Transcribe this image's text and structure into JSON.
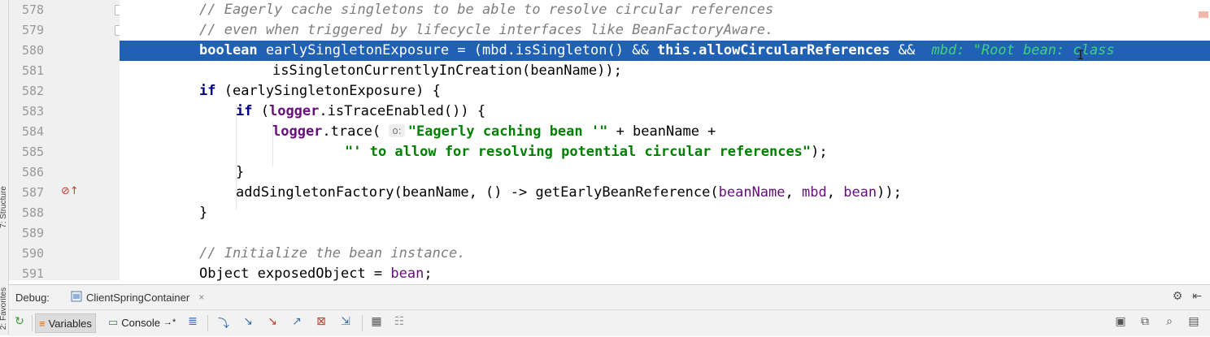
{
  "gutter": {
    "line_numbers": [
      "578",
      "579",
      "580",
      "581",
      "582",
      "583",
      "584",
      "585",
      "586",
      "587",
      "588",
      "589",
      "590",
      "591"
    ]
  },
  "code": {
    "l578": "// Eagerly cache singletons to be able to resolve circular references",
    "l579": "// even when triggered by lifecycle interfaces like BeanFactoryAware.",
    "l580_kw": "boolean",
    "l580_a": " earlySingletonExposure = (mbd.isSingleton() && ",
    "l580_this": "this",
    "l580_b": ".allowCircularReferences",
    "l580_c": " && ",
    "l580_hint": "mbd: \"Root bean: class",
    "l581": "isSingletonCurrentlyInCreation(beanName));",
    "l582_kw": "if",
    "l582": " (earlySingletonExposure) {",
    "l583_kw": "if",
    "l583_a": " (",
    "l583_logger": "logger",
    "l583_b": ".isTraceEnabled()) {",
    "l584_logger": "logger",
    "l584_a": ".trace( ",
    "l584_hint": "o:",
    "l584_str": "\"Eagerly caching bean '\"",
    "l584_b": " + beanName +",
    "l585_str": "\"' to allow for resolving potential circular references\"",
    "l585_b": ");",
    "l586": "}",
    "l587_a": "addSingletonFactory(beanName, () -> getEarlyBeanReference(",
    "l587_p1": "beanName",
    "l587_c1": ", ",
    "l587_p2": "mbd",
    "l587_c2": ", ",
    "l587_p3": "bean",
    "l587_b": "));",
    "l588": "}",
    "l589": "",
    "l590": "// Initialize the bean instance.",
    "l591_a": "Object exposedObject = ",
    "l591_p": "bean",
    "l591_b": ";"
  },
  "debug": {
    "title": "Debug:",
    "session_name": "ClientSpringContainer",
    "close_glyph": "×",
    "settings_glyph": "⚙",
    "minimize_glyph": "⇤",
    "variables_label": "Variables",
    "console_label": "Console",
    "console_suffix": "→*"
  },
  "left_strip": {
    "structure_label": "7: Structure",
    "favorites_label": "2: Favorites"
  },
  "colors": {
    "current_line": "#2161b5",
    "comment": "#7d7d7d",
    "keyword": "#000080",
    "string": "#008000",
    "field": "#660e7a",
    "inline_hint": "#3fd27a"
  }
}
